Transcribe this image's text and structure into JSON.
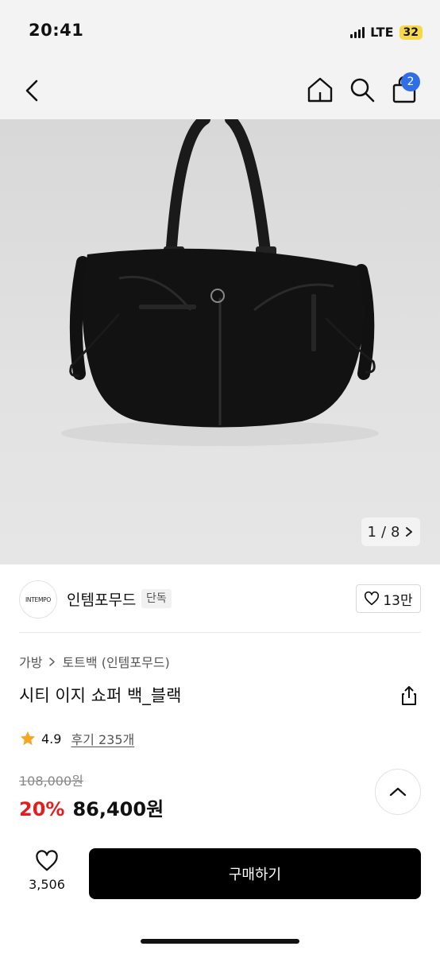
{
  "status_bar": {
    "time": "20:41",
    "network": "LTE",
    "battery": "32"
  },
  "nav": {
    "back_icon": "chevron-left-icon",
    "home_icon": "home-icon",
    "search_icon": "search-icon",
    "cart_icon": "shopping-bag-icon",
    "cart_badge": "2"
  },
  "gallery": {
    "current": "1",
    "separator": "/",
    "total": "8"
  },
  "brand": {
    "logo_text": "INTEMPO",
    "name": "인템포무드",
    "tag": "단독",
    "likes": "13만"
  },
  "product": {
    "breadcrumb": [
      "가방",
      "토트백 (인템포무드)"
    ],
    "title": "시티 이지 쇼퍼 백_블랙",
    "rating": "4.9",
    "reviews": "후기 235개",
    "original_price": "108,000원",
    "discount": "20%",
    "price": "86,400원"
  },
  "bottom_bar": {
    "wish_count": "3,506",
    "buy_label": "구매하기"
  },
  "colors": {
    "accent": "#2f6ee6",
    "discount": "#e02020",
    "star": "#f5a623",
    "buy_button": "#000000"
  }
}
